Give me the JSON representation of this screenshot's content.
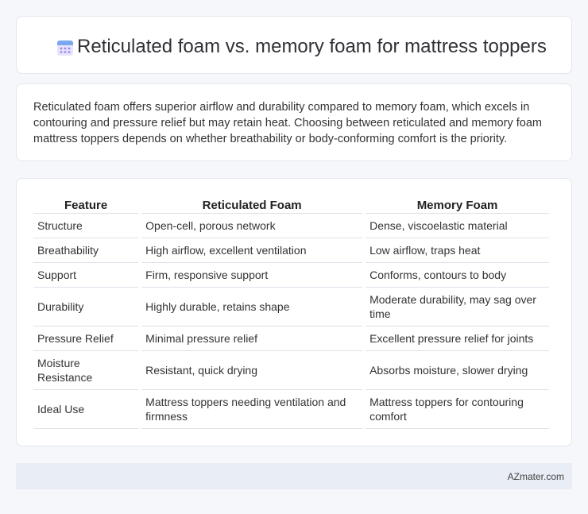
{
  "header": {
    "title": "Reticulated foam vs. memory foam for mattress toppers",
    "icon": "calendar-icon"
  },
  "intro": {
    "text": "Reticulated foam offers superior airflow and durability compared to memory foam, which excels in contouring and pressure relief but may retain heat. Choosing between reticulated and memory foam mattress toppers depends on whether breathability or body-conforming comfort is the priority."
  },
  "table": {
    "headers": [
      "Feature",
      "Reticulated Foam",
      "Memory Foam"
    ],
    "rows": [
      [
        "Structure",
        "Open-cell, porous network",
        "Dense, viscoelastic material"
      ],
      [
        "Breathability",
        "High airflow, excellent ventilation",
        "Low airflow, traps heat"
      ],
      [
        "Support",
        "Firm, responsive support",
        "Conforms, contours to body"
      ],
      [
        "Durability",
        "Highly durable, retains shape",
        "Moderate durability, may sag over time"
      ],
      [
        "Pressure Relief",
        "Minimal pressure relief",
        "Excellent pressure relief for joints"
      ],
      [
        "Moisture Resistance",
        "Resistant, quick drying",
        "Absorbs moisture, slower drying"
      ],
      [
        "Ideal Use",
        "Mattress toppers needing ventilation and firmness",
        "Mattress toppers for contouring comfort"
      ]
    ]
  },
  "footer": {
    "brand": "AZmater.com"
  },
  "colors": {
    "background": "#f5f7fa",
    "card": "#ffffff",
    "footer": "#e9eef6",
    "icon_accent": "#8a7cf0"
  }
}
